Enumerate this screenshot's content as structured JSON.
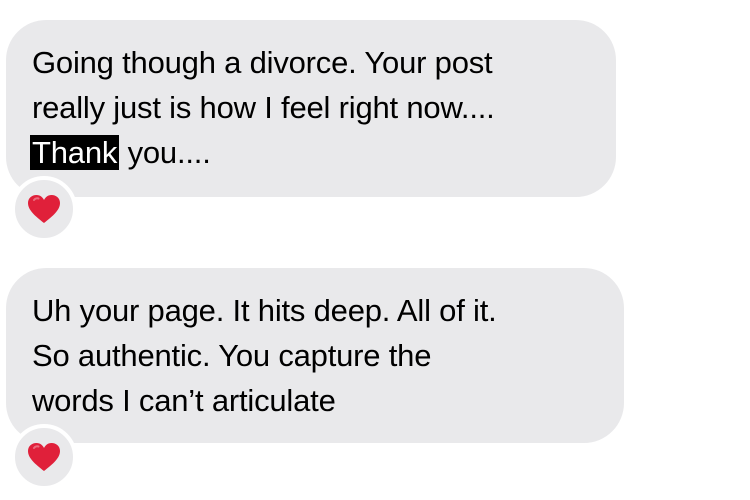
{
  "messages": [
    {
      "lines": [
        "Going though a divorce. Your post",
        "really just is how I feel right now...."
      ],
      "highlighted_word": "Thank",
      "after_highlight": " you....",
      "reaction": {
        "icon": "red-heart-icon",
        "color": "#e0203a"
      }
    },
    {
      "lines": [
        "Uh your page. It hits deep. All of it.",
        "So authentic. You capture the",
        "words I can’t articulate"
      ],
      "reaction": {
        "icon": "red-heart-icon",
        "color": "#e0203a"
      }
    }
  ],
  "colors": {
    "bubble": "#e9e9eb",
    "text": "#000000",
    "selection_bg": "#000000",
    "selection_text": "#ffffff"
  }
}
